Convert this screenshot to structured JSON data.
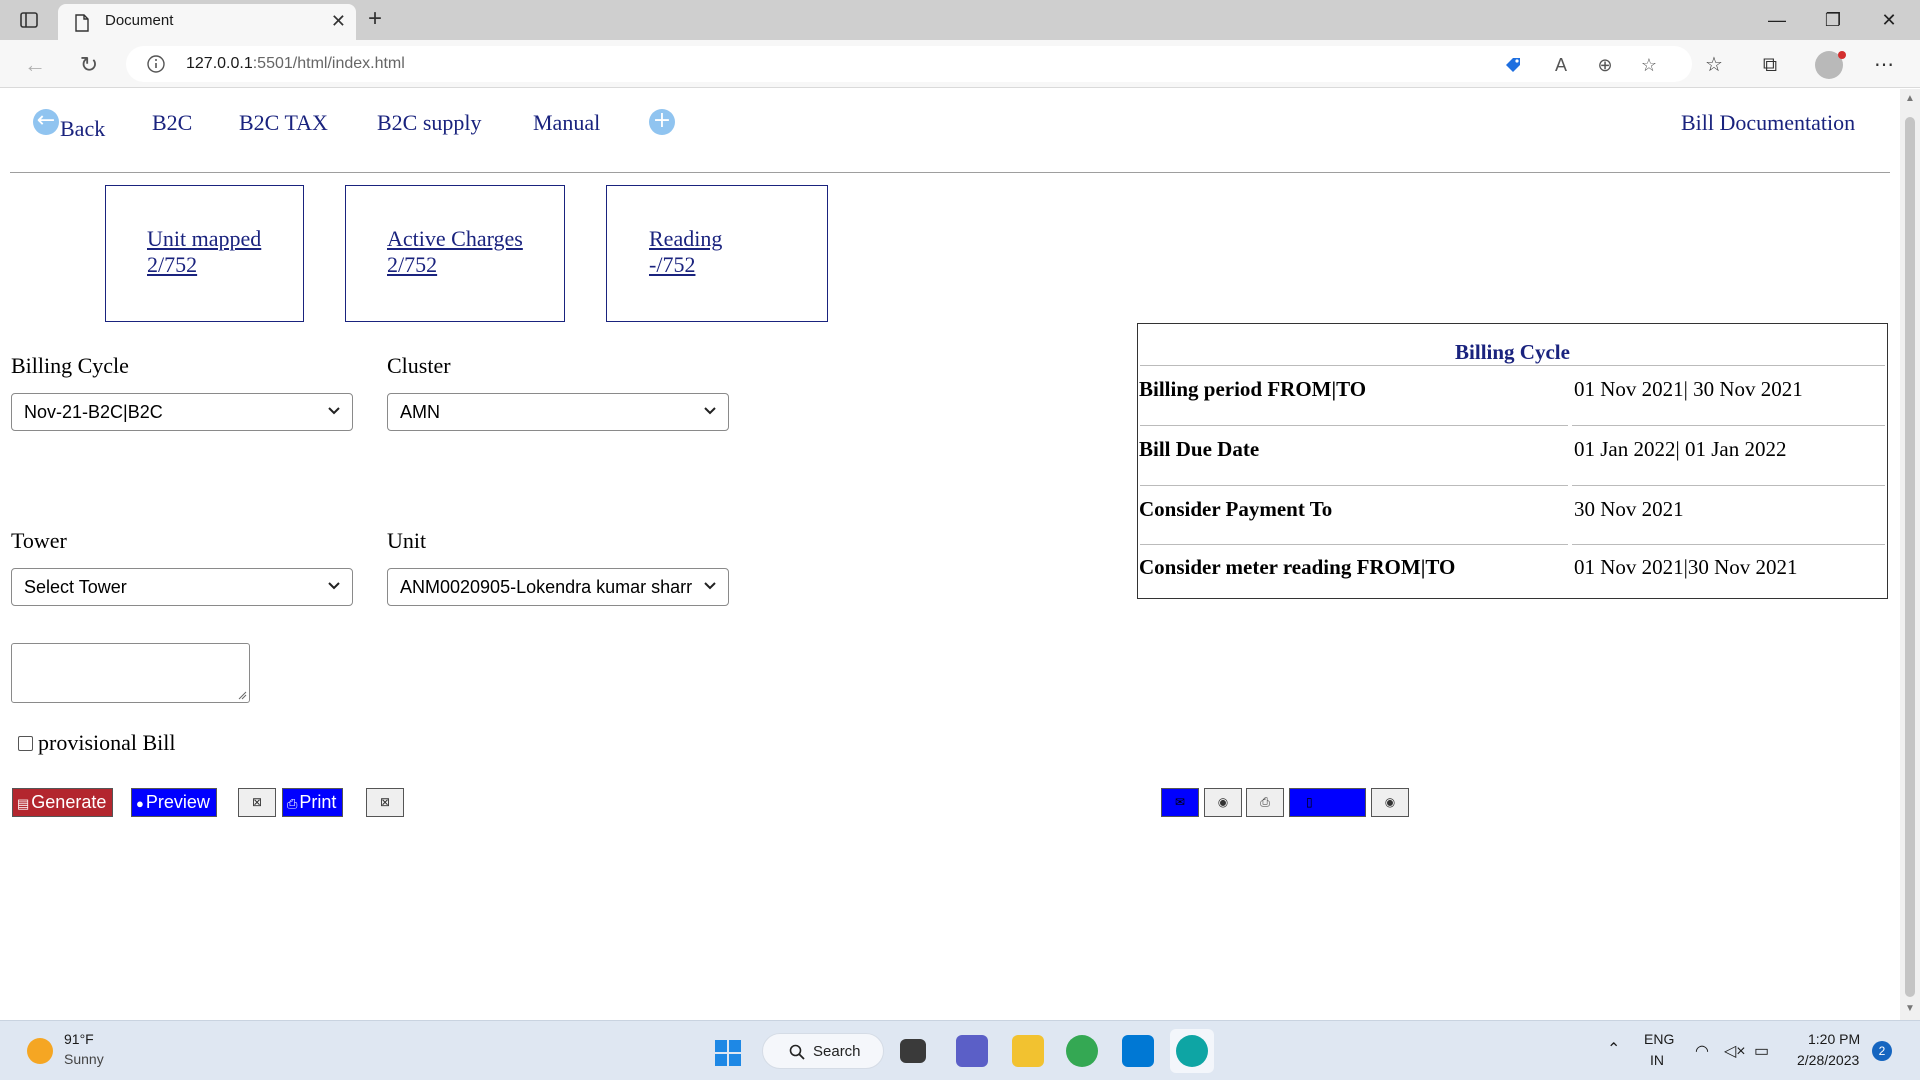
{
  "browser": {
    "tab_title": "Document",
    "url_host": "127.0.0.1",
    "url_rest": ":5501/html/index.html",
    "icons": [
      "tab-actions-icon",
      "document-icon",
      "close-icon",
      "plus-icon",
      "minimize-icon",
      "restore-icon",
      "back-arrow-icon",
      "refresh-icon",
      "info-icon",
      "tag-icon",
      "read-aloud-icon",
      "zoom-icon",
      "add-favorite-icon",
      "favorites-icon",
      "collections-icon",
      "profile-icon",
      "more-icon"
    ]
  },
  "nav": {
    "back": "Back",
    "links": [
      "B2C",
      "B2C TAX",
      "B2C supply",
      "Manual"
    ],
    "right_link": "Bill Documentation"
  },
  "cards": [
    {
      "title": "Unit mapped",
      "value": "2/752"
    },
    {
      "title": "Active Charges",
      "value": "2/752"
    },
    {
      "title": "Reading",
      "value": "-/752"
    }
  ],
  "form": {
    "billing_cycle_label": "Billing Cycle",
    "billing_cycle_value": "Nov-21-B2C|B2C",
    "cluster_label": "Cluster",
    "cluster_value": "AMN",
    "tower_label": "Tower",
    "tower_value": "Select Tower",
    "unit_label": "Unit",
    "unit_value": "ANM0020905-Lokendra kumar sharr",
    "provisional_label": "provisional Bill",
    "provisional_checked": false
  },
  "buttons": {
    "generate": "Generate",
    "preview": "Preview",
    "print": "Print",
    "colors": {
      "generate": "#b3262e",
      "primary": "#0000ff"
    }
  },
  "billing_cycle_table": {
    "title": "Billing Cycle",
    "rows": [
      {
        "key": "Billing period FROM|TO",
        "value": "01 Nov 2021| 30 Nov 2021"
      },
      {
        "key": "Bill Due Date",
        "value": "01 Jan 2022| 01 Jan 2022"
      },
      {
        "key": "Consider Payment To",
        "value": "30 Nov 2021"
      },
      {
        "key": "Consider meter reading FROM|TO",
        "value": "01 Nov 2021|30 Nov 2021"
      }
    ]
  },
  "taskbar": {
    "temperature": "91°F",
    "weather": "Sunny",
    "search": "Search",
    "lang_1": "ENG",
    "lang_2": "IN",
    "time": "1:20 PM",
    "date": "2/28/2023",
    "notifications": "2"
  }
}
